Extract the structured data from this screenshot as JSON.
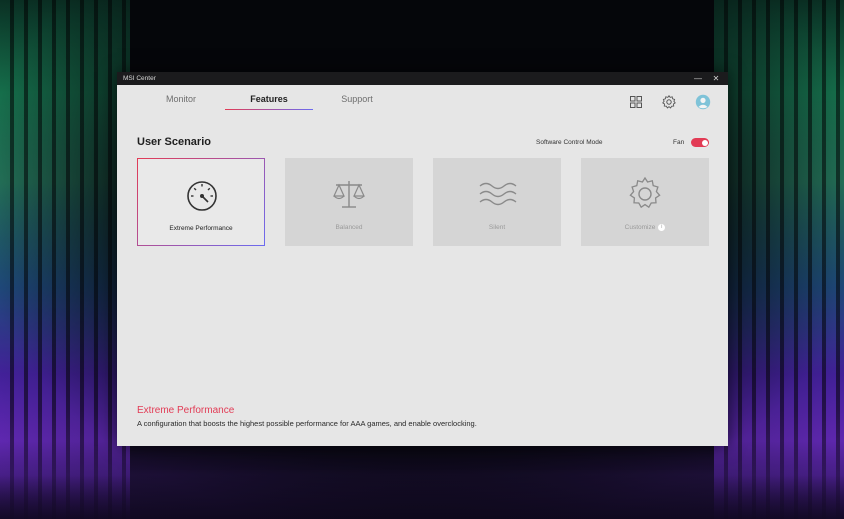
{
  "window": {
    "title": "MSI Center"
  },
  "nav": {
    "tabs": [
      {
        "label": "Monitor",
        "active": false
      },
      {
        "label": "Features",
        "active": true
      },
      {
        "label": "Support",
        "active": false
      }
    ],
    "icons": [
      "apps-grid-icon",
      "gear-icon",
      "user-avatar-icon"
    ]
  },
  "section": {
    "title": "User Scenario",
    "software_control_mode_label": "Software Control Mode",
    "fan_label": "Fan",
    "fan_enabled": true
  },
  "scenarios": [
    {
      "label": "Extreme Performance",
      "icon": "speedometer-icon",
      "selected": true
    },
    {
      "label": "Balanced",
      "icon": "scale-icon",
      "selected": false
    },
    {
      "label": "Silent",
      "icon": "waves-icon",
      "selected": false
    },
    {
      "label": "Customize",
      "icon": "gear-icon",
      "selected": false,
      "has_info": true
    }
  ],
  "description": {
    "title": "Extreme Performance",
    "text": "A configuration that boosts the highest possible performance for AAA games, and enable overclocking."
  },
  "colors": {
    "accent_red": "#e23b55",
    "accent_purple": "#6b6bf0",
    "window_bg": "#e6e6e6",
    "titlebar_bg": "#1b1b1d"
  }
}
